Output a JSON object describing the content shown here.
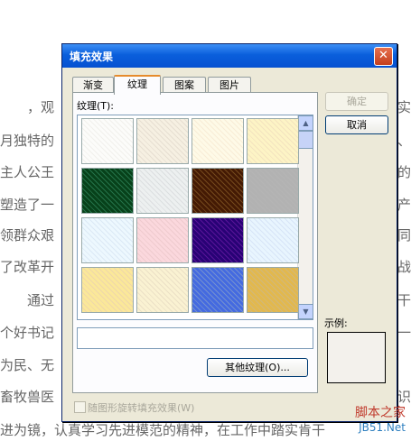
{
  "document": {
    "lines": [
      {
        "text": "，观",
        "right": "实"
      },
      {
        "text": "月独特的",
        "right": "、"
      },
      {
        "text": "主人公王",
        "right": "的"
      },
      {
        "text": "塑造了一",
        "right": "产"
      },
      {
        "text": "领群众艰",
        "right": "同"
      },
      {
        "text": "了改革开",
        "right": "战"
      },
      {
        "text": "通过",
        "right": "干"
      },
      {
        "text": "个好书记",
        "right": "一"
      },
      {
        "text": "为民、无",
        "right": ""
      },
      {
        "text": "畜牧兽医",
        "right": "识"
      }
    ],
    "bottom_line": "进为镜，认真学习先进模范的精神，在工作中踏实肯干"
  },
  "dialog": {
    "title": "填充效果",
    "close_symbol": "✕",
    "tabs": [
      {
        "label": "渐变",
        "active": false
      },
      {
        "label": "纹理",
        "active": true
      },
      {
        "label": "图案",
        "active": false
      },
      {
        "label": "图片",
        "active": false
      }
    ],
    "texture_label": "纹理(T):",
    "textures": [
      {
        "name": "纸莎草纸",
        "color": "#ecebe6"
      },
      {
        "name": "画布",
        "color": "#ddd3c2"
      },
      {
        "name": "羊皮纸",
        "color": "#f6e6c8"
      },
      {
        "name": "再生纸",
        "color": "#efd9a9"
      },
      {
        "name": "绿色大理石",
        "color": "#1d5b3a"
      },
      {
        "name": "白色大理石",
        "color": "#cfd3d4"
      },
      {
        "name": "褐色大理石",
        "color": "#5d3a16"
      },
      {
        "name": "花岗岩",
        "color": "#9c9c9c"
      },
      {
        "name": "蓝色面巾纸",
        "color": "#cfe1f2"
      },
      {
        "name": "粉色面巾纸",
        "color": "#e8b8bd"
      },
      {
        "name": "紫色网格",
        "color": "#47107a"
      },
      {
        "name": "花束",
        "color": "#c9dbf4"
      },
      {
        "name": "麻布",
        "color": "#e8c98d"
      },
      {
        "name": "编织物",
        "color": "#e5d6b3"
      },
      {
        "name": "斜纹布",
        "color": "#5d74c0"
      },
      {
        "name": "编织物2",
        "color": "#c2a063"
      }
    ],
    "texture_name_value": "",
    "other_texture_button": "其他纹理(O)...",
    "rotate_checkbox_label": "随图形旋转填充效果(W)",
    "rotate_checked": false,
    "ok_button": "确定",
    "cancel_button": "取消",
    "sample_label": "示例:",
    "sample_color": "#f3f1ec"
  },
  "watermark": {
    "line1": "脚本之家",
    "line2": "JB51.Net"
  }
}
